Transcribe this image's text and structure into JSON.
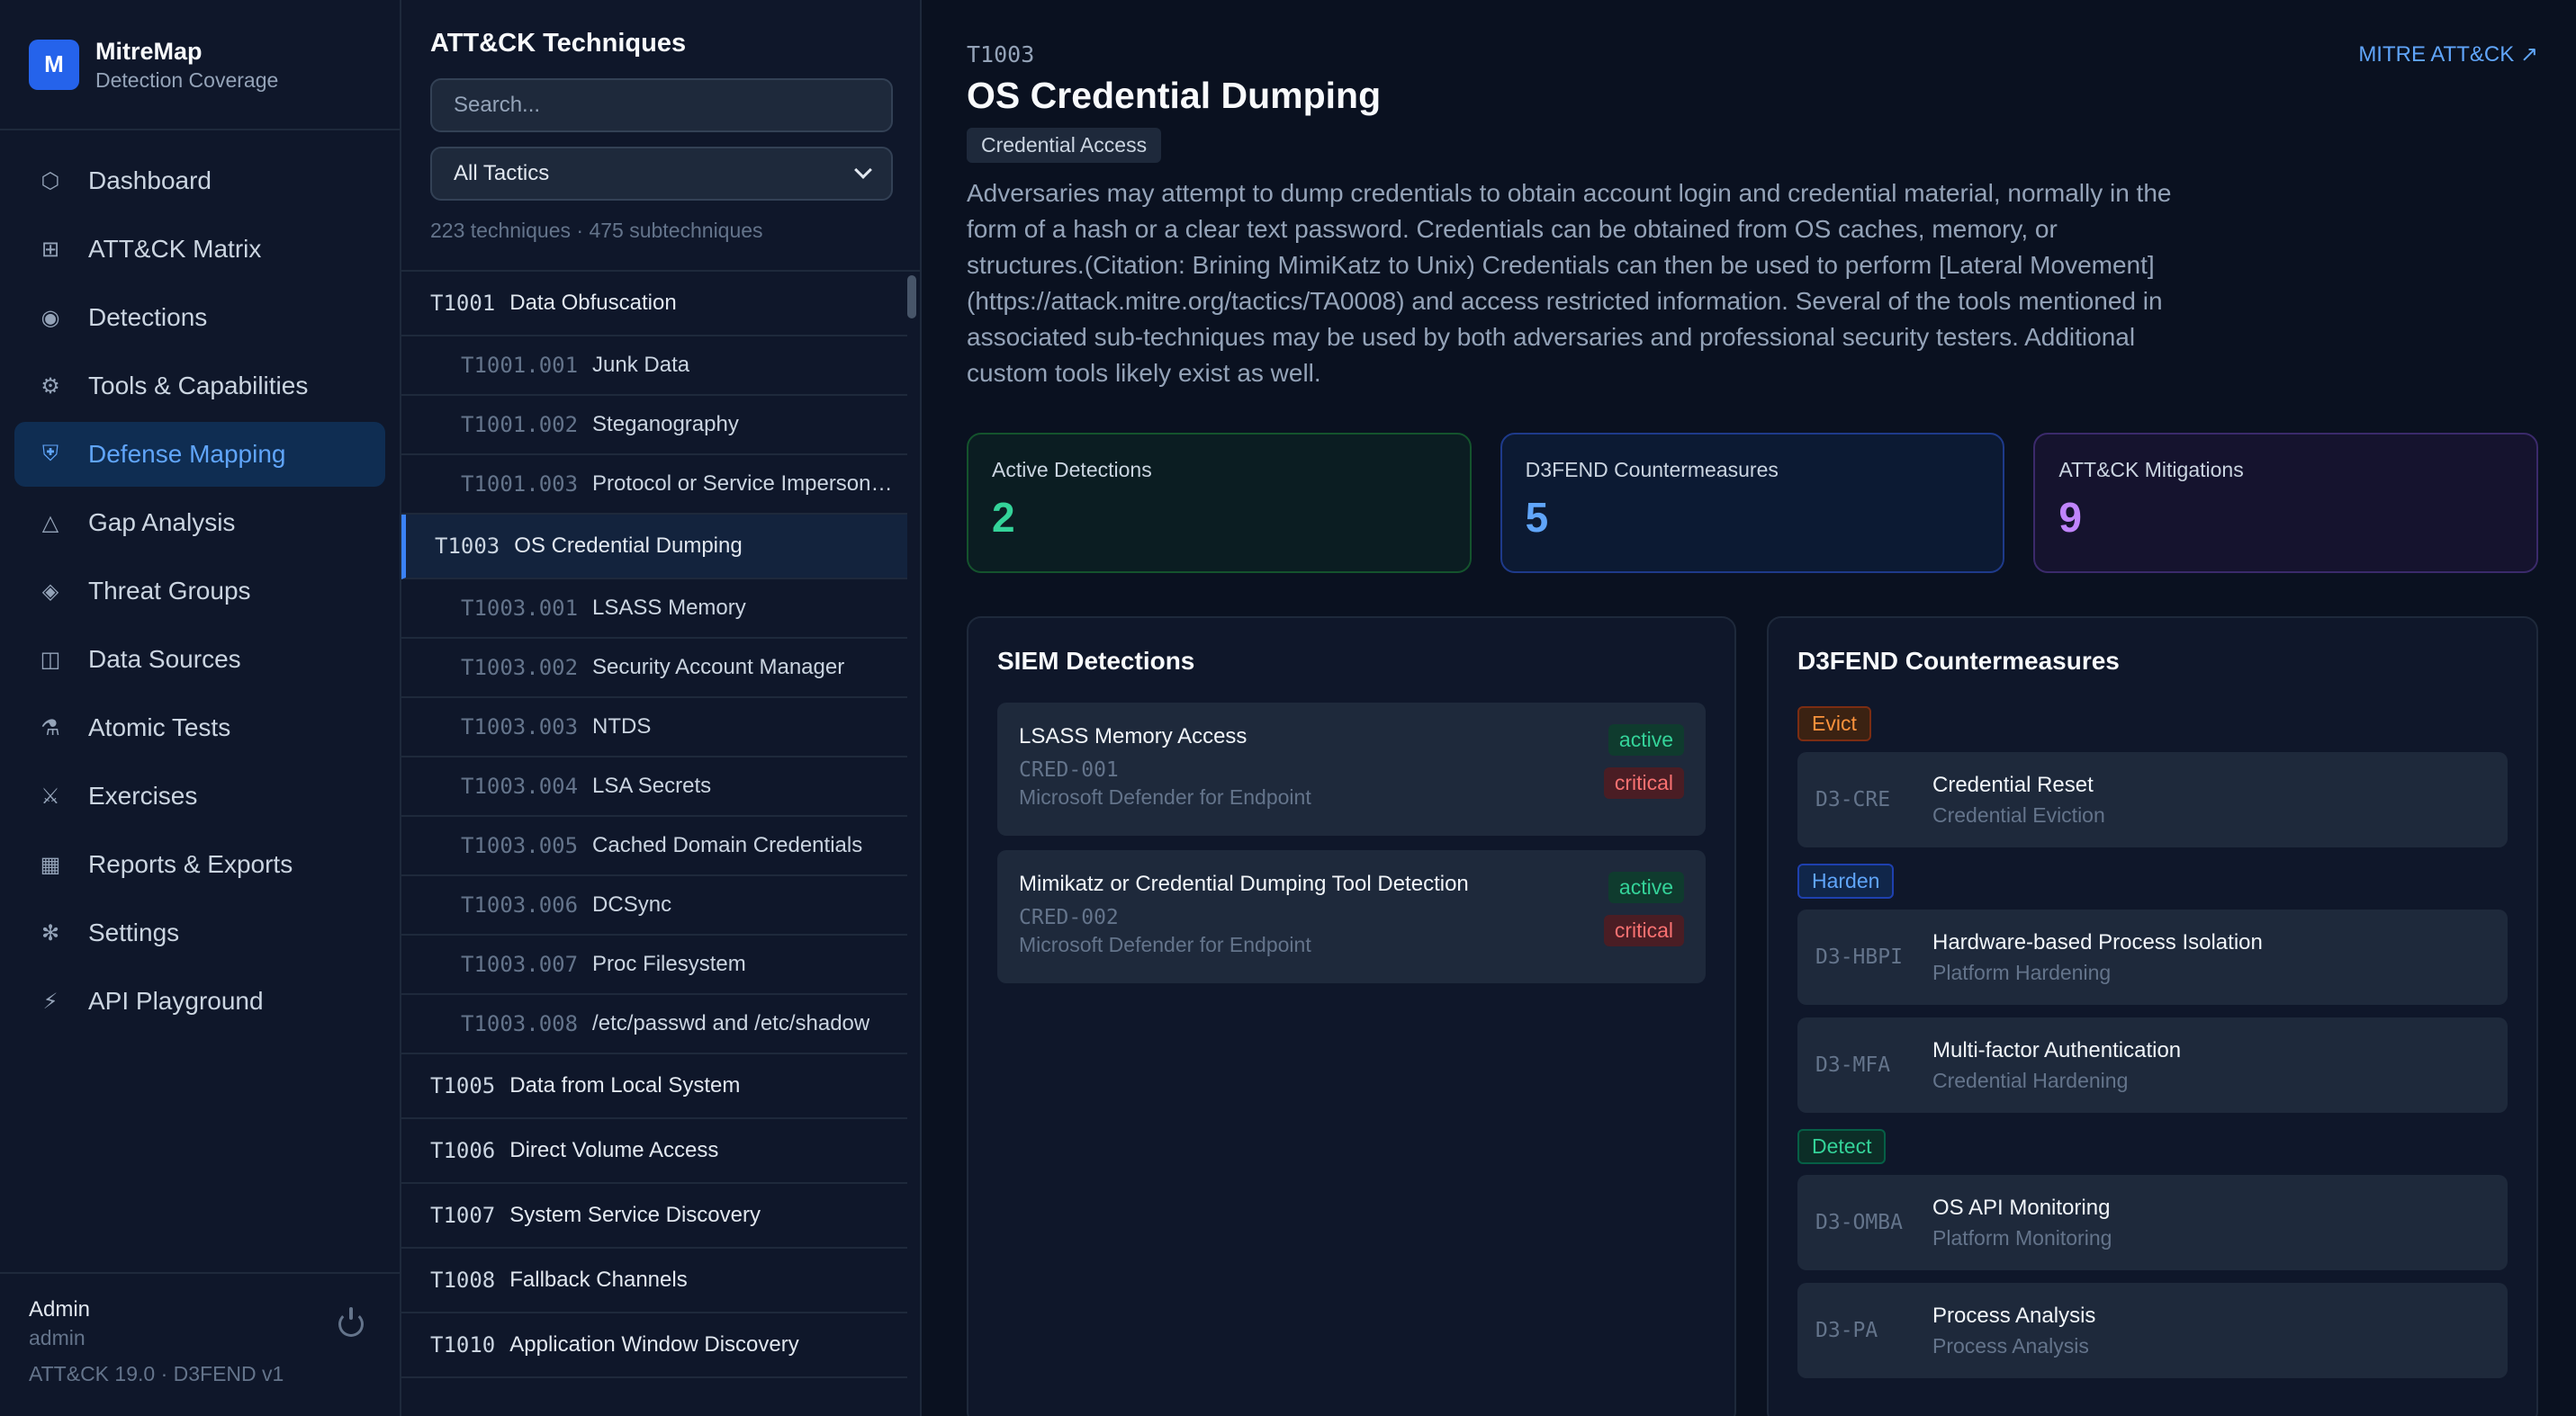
{
  "brand": {
    "logo": "M",
    "title": "MitreMap",
    "subtitle": "Detection Coverage"
  },
  "nav": [
    {
      "label": "Dashboard",
      "icon": "⬡",
      "icon_name": "dashboard-icon"
    },
    {
      "label": "ATT&CK Matrix",
      "icon": "⊞",
      "icon_name": "matrix-icon"
    },
    {
      "label": "Detections",
      "icon": "◉",
      "icon_name": "detections-icon"
    },
    {
      "label": "Tools & Capabilities",
      "icon": "⚙",
      "icon_name": "tools-icon"
    },
    {
      "label": "Defense Mapping",
      "icon": "⛨",
      "icon_name": "shield-icon",
      "active": true
    },
    {
      "label": "Gap Analysis",
      "icon": "△",
      "icon_name": "gap-icon"
    },
    {
      "label": "Threat Groups",
      "icon": "◈",
      "icon_name": "threat-icon"
    },
    {
      "label": "Data Sources",
      "icon": "◫",
      "icon_name": "data-sources-icon"
    },
    {
      "label": "Atomic Tests",
      "icon": "⚗",
      "icon_name": "flask-icon"
    },
    {
      "label": "Exercises",
      "icon": "⚔",
      "icon_name": "swords-icon"
    },
    {
      "label": "Reports & Exports",
      "icon": "▦",
      "icon_name": "reports-icon"
    },
    {
      "label": "Settings",
      "icon": "✻",
      "icon_name": "settings-icon"
    },
    {
      "label": "API Playground",
      "icon": "⚡",
      "icon_name": "lightning-icon"
    }
  ],
  "footer": {
    "user": "Admin",
    "role": "admin",
    "version": "ATT&CK 19.0 · D3FEND v1"
  },
  "techniques": {
    "title": "ATT&CK Techniques",
    "search_placeholder": "Search...",
    "tactic_filter": "All Tactics",
    "counts": "223 techniques · 475 subtechniques",
    "rows": [
      {
        "id": "T1001",
        "name": "Data Obfuscation",
        "sub": false
      },
      {
        "id": "T1001.001",
        "name": "Junk Data",
        "sub": true
      },
      {
        "id": "T1001.002",
        "name": "Steganography",
        "sub": true
      },
      {
        "id": "T1001.003",
        "name": "Protocol or Service Impersonation",
        "sub": true
      },
      {
        "id": "T1003",
        "name": "OS Credential Dumping",
        "sub": false,
        "selected": true
      },
      {
        "id": "T1003.001",
        "name": "LSASS Memory",
        "sub": true
      },
      {
        "id": "T1003.002",
        "name": "Security Account Manager",
        "sub": true
      },
      {
        "id": "T1003.003",
        "name": "NTDS",
        "sub": true
      },
      {
        "id": "T1003.004",
        "name": "LSA Secrets",
        "sub": true
      },
      {
        "id": "T1003.005",
        "name": "Cached Domain Credentials",
        "sub": true
      },
      {
        "id": "T1003.006",
        "name": "DCSync",
        "sub": true
      },
      {
        "id": "T1003.007",
        "name": "Proc Filesystem",
        "sub": true
      },
      {
        "id": "T1003.008",
        "name": "/etc/passwd and /etc/shadow",
        "sub": true
      },
      {
        "id": "T1005",
        "name": "Data from Local System",
        "sub": false
      },
      {
        "id": "T1006",
        "name": "Direct Volume Access",
        "sub": false
      },
      {
        "id": "T1007",
        "name": "System Service Discovery",
        "sub": false
      },
      {
        "id": "T1008",
        "name": "Fallback Channels",
        "sub": false
      },
      {
        "id": "T1010",
        "name": "Application Window Discovery",
        "sub": false
      }
    ]
  },
  "detail": {
    "code": "T1003",
    "external_link": "MITRE ATT&CK ↗",
    "title": "OS Credential Dumping",
    "tactic": "Credential Access",
    "description": "Adversaries may attempt to dump credentials to obtain account login and credential material, normally in the form of a hash or a clear text password. Credentials can be obtained from OS caches, memory, or structures.(Citation: Brining MimiKatz to Unix) Credentials can then be used to perform [Lateral Movement](https://attack.mitre.org/tactics/TA0008) and access restricted information. Several of the tools mentioned in associated sub-techniques may be used by both adversaries and professional security testers. Additional custom tools likely exist as well.",
    "stats": [
      {
        "label": "Active Detections",
        "value": "2",
        "color": "#34d399",
        "cls": "g"
      },
      {
        "label": "D3FEND Countermeasures",
        "value": "5",
        "color": "#60a5fa",
        "cls": "b"
      },
      {
        "label": "ATT&CK Mitigations",
        "value": "9",
        "color": "#c084fc",
        "cls": "p"
      }
    ]
  },
  "siem": {
    "title": "SIEM Detections",
    "items": [
      {
        "name": "LSASS Memory Access",
        "id": "CRED-001",
        "source": "Microsoft Defender for Endpoint",
        "status": "active",
        "severity": "critical"
      },
      {
        "name": "Mimikatz or Credential Dumping Tool Detection",
        "id": "CRED-002",
        "source": "Microsoft Defender for Endpoint",
        "status": "active",
        "severity": "critical"
      }
    ]
  },
  "d3fend": {
    "title": "D3FEND Countermeasures",
    "groups": [
      {
        "category": "Evict",
        "cls": "evict",
        "items": [
          {
            "id": "D3-CRE",
            "name": "Credential Reset",
            "sub": "Credential Eviction"
          }
        ]
      },
      {
        "category": "Harden",
        "cls": "harden",
        "items": [
          {
            "id": "D3-HBPI",
            "name": "Hardware-based Process Isolation",
            "sub": "Platform Hardening"
          },
          {
            "id": "D3-MFA",
            "name": "Multi-factor Authentication",
            "sub": "Credential Hardening"
          }
        ]
      },
      {
        "category": "Detect",
        "cls": "detect",
        "items": [
          {
            "id": "D3-OMBA",
            "name": "OS API Monitoring",
            "sub": "Platform Monitoring"
          },
          {
            "id": "D3-PA",
            "name": "Process Analysis",
            "sub": "Process Analysis"
          }
        ]
      }
    ]
  }
}
